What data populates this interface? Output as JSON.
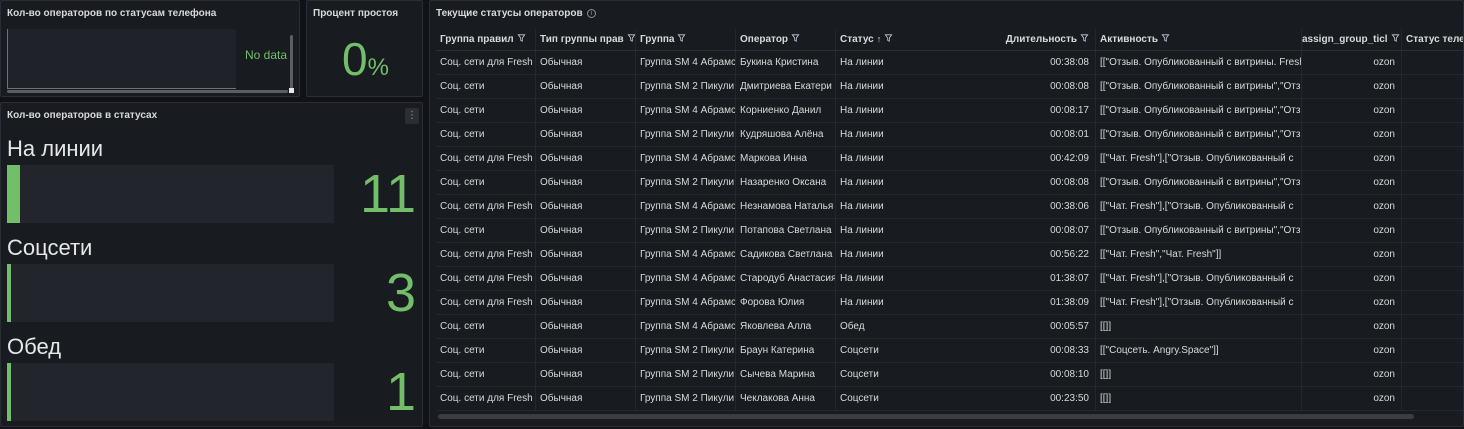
{
  "panel_phone_status": {
    "title": "Кол-во операторов по статусам телефона",
    "no_data": "No data"
  },
  "panel_idle": {
    "title": "Процент простоя",
    "value": "0",
    "unit": "%"
  },
  "panel_status_counts": {
    "title": "Кол-во операторов в статусах",
    "menu_icon": "more-vertical-icon",
    "items": [
      {
        "label": "На линии",
        "value": "11",
        "fill_fraction": 0.04
      },
      {
        "label": "Соцсети",
        "value": "3",
        "fill_fraction": 0.01
      },
      {
        "label": "Обед",
        "value": "1",
        "fill_fraction": 0.005
      }
    ]
  },
  "panel_table": {
    "title": "Текущие статусы операторов",
    "info_icon": "info-icon",
    "columns": [
      "Группа правил",
      "Тип группы прав",
      "Группа",
      "Оператор",
      "Статус",
      "Длительность",
      "Активность",
      "assign_group_ticl",
      "Статус теле"
    ],
    "sort_indicator": "↑",
    "rows": [
      [
        "Соц. сети для Fresh",
        "Обычная",
        "Группа SM 4 Абрамс",
        "Букина Кристина",
        "На линии",
        "00:38:08",
        "[[\"Отзыв. Опубликованный с витрины. Fresh",
        "ozon",
        ""
      ],
      [
        "Соц. сети",
        "Обычная",
        "Группа SM 2 Пикули",
        "Дмитриева Екатери",
        "На линии",
        "00:08:08",
        "[[\"Отзыв. Опубликованный с витрины\",\"Отз",
        "ozon",
        ""
      ],
      [
        "Соц. сети",
        "Обычная",
        "Группа SM 4 Абрамс",
        "Корниенко Данил",
        "На линии",
        "00:08:17",
        "[[\"Отзыв. Опубликованный с витрины\",\"Отз",
        "ozon",
        ""
      ],
      [
        "Соц. сети",
        "Обычная",
        "Группа SM 2 Пикули",
        "Кудряшова Алёна",
        "На линии",
        "00:08:01",
        "[[\"Отзыв. Опубликованный с витрины\",\"Отз",
        "ozon",
        ""
      ],
      [
        "Соц. сети для Fresh",
        "Обычная",
        "Группа SM 4 Абрамс",
        "Маркова Инна",
        "На линии",
        "00:42:09",
        "[[\"Чат. Fresh\"],[\"Отзыв. Опубликованный с",
        "ozon",
        ""
      ],
      [
        "Соц. сети",
        "Обычная",
        "Группа SM 2 Пикули",
        "Назаренко Оксана",
        "На линии",
        "00:08:08",
        "[[\"Отзыв. Опубликованный с витрины\",\"Отз",
        "ozon",
        ""
      ],
      [
        "Соц. сети для Fresh",
        "Обычная",
        "Группа SM 4 Абрамс",
        "Незнамова Наталья",
        "На линии",
        "00:38:06",
        "[[\"Чат. Fresh\"],[\"Отзыв. Опубликованный с",
        "ozon",
        ""
      ],
      [
        "Соц. сети",
        "Обычная",
        "Группа SM 2 Пикули",
        "Потапова Светлана",
        "На линии",
        "00:08:07",
        "[[\"Отзыв. Опубликованный с витрины\",\"Отз",
        "ozon",
        ""
      ],
      [
        "Соц. сети для Fresh",
        "Обычная",
        "Группа SM 4 Абрамс",
        "Садикова Светлана",
        "На линии",
        "00:56:22",
        "[[\"Чат. Fresh\",\"Чат. Fresh\"]]",
        "ozon",
        ""
      ],
      [
        "Соц. сети для Fresh",
        "Обычная",
        "Группа SM 4 Абрамс",
        "Стародуб Анастасия",
        "На линии",
        "01:38:07",
        "[[\"Чат. Fresh\"],[\"Отзыв. Опубликованный с",
        "ozon",
        ""
      ],
      [
        "Соц. сети для Fresh",
        "Обычная",
        "Группа SM 4 Абрамс",
        "Форова Юлия",
        "На линии",
        "01:38:09",
        "[[\"Чат. Fresh\"],[\"Отзыв. Опубликованный с",
        "ozon",
        ""
      ],
      [
        "Соц. сети",
        "Обычная",
        "Группа SM 4 Абрамс",
        "Яковлева Алла",
        "Обед",
        "00:05:57",
        "[[]]",
        "ozon",
        ""
      ],
      [
        "Соц. сети",
        "Обычная",
        "Группа SM 2 Пикули",
        "Браун Катерина",
        "Соцсети",
        "00:08:33",
        "[[\"Соцсеть. Angry.Space\"]]",
        "ozon",
        ""
      ],
      [
        "Соц. сети",
        "Обычная",
        "Группа SM 2 Пикули",
        "Сычева Марина",
        "Соцсети",
        "00:08:10",
        "[[]]",
        "ozon",
        ""
      ],
      [
        "Соц. сети для Fresh",
        "Обычная",
        "Группа SM 2 Пикули",
        "Чеклакова Анна",
        "Соцсети",
        "00:23:50",
        "[[]]",
        "ozon",
        ""
      ]
    ]
  },
  "colors": {
    "background": "#111217",
    "panel": "#181b1f",
    "accent_green": "#73bf69"
  }
}
